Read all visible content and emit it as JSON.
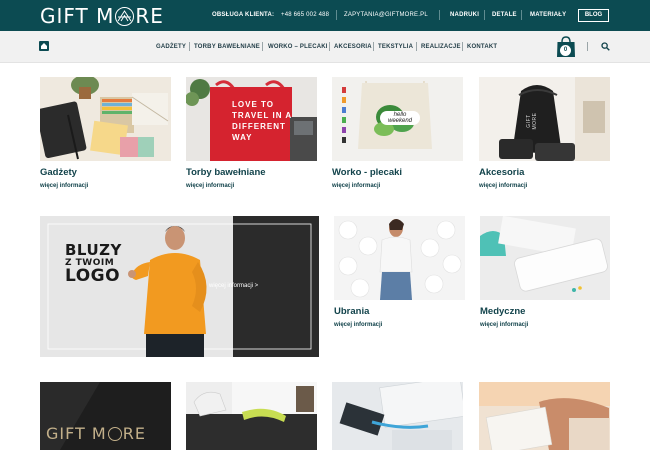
{
  "header": {
    "logo_left": "GIFT M",
    "logo_right": "RE",
    "customer_service_label": "OBSŁUGA KLIENTA:",
    "phone": "+48 665 002 488",
    "email": "ZAPYTANIA@GIFTMORE.PL",
    "links": [
      "NADRUKI",
      "DETALE",
      "MATERIAŁY"
    ],
    "blog_label": "BLOG",
    "colors": {
      "brand": "#0c4b52"
    }
  },
  "nav": {
    "home_icon": "home-icon",
    "items": [
      "GADŻETY",
      "TORBY BAWEŁNIANE",
      "WORKO – PLECAKI",
      "AKCESORIA",
      "TEKSTYLIA",
      "REALIZACJE",
      "KONTAKT"
    ],
    "cart_count": "0",
    "search_icon": "search-icon"
  },
  "products": [
    {
      "title": "Gadżety",
      "more": "więcej informacji"
    },
    {
      "title": "Torby bawełniane",
      "more": "więcej informacji",
      "image_text": "LOVE TO TRAVEL IN A DIFFERENT WAY"
    },
    {
      "title": "Worko - plecaki",
      "more": "więcej informacji",
      "image_text": "hello weekend"
    },
    {
      "title": "Akcesoria",
      "more": "więcej informacji",
      "image_text": "GIFT MORE"
    },
    {
      "title": "Ubrania",
      "more": "więcej informacji"
    },
    {
      "title": "Medyczne",
      "more": "więcej informacji"
    }
  ],
  "banner": {
    "line1": "BLUZY",
    "line2": "Z TWOIM",
    "line3": "LOGO",
    "link": "więcej informacji >"
  },
  "bottom_row": {
    "logo_left": "GIFT M",
    "logo_right": "RE"
  }
}
